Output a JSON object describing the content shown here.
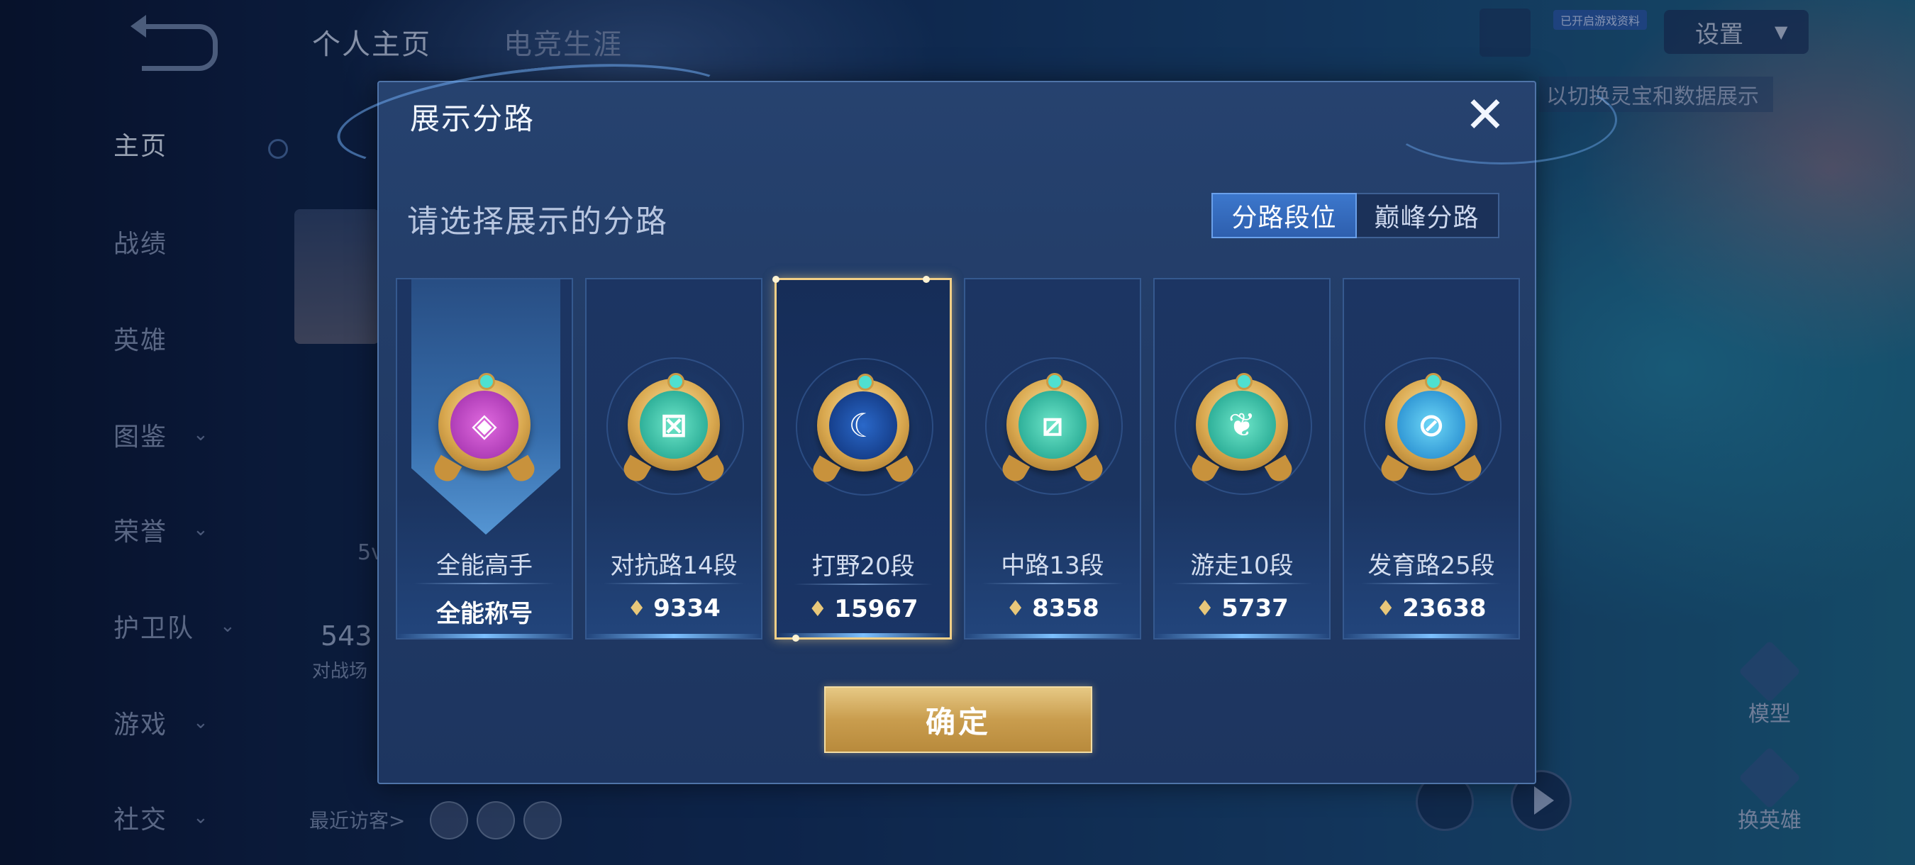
{
  "background": {
    "top_tabs": [
      "个人主页",
      "电竞生涯"
    ],
    "nav_items": [
      {
        "label": "主页",
        "has_chevron": false,
        "active": true
      },
      {
        "label": "战绩",
        "has_chevron": false,
        "active": false
      },
      {
        "label": "英雄",
        "has_chevron": false,
        "active": false
      },
      {
        "label": "图鉴",
        "has_chevron": true,
        "active": false
      },
      {
        "label": "荣誉",
        "has_chevron": true,
        "active": false
      },
      {
        "label": "护卫队",
        "has_chevron": true,
        "active": false
      },
      {
        "label": "游戏",
        "has_chevron": true,
        "active": false
      },
      {
        "label": "社交",
        "has_chevron": true,
        "active": false
      }
    ],
    "settings_label": "设置",
    "hint_text": "以切换灵宝和数据展示",
    "top_badge": "已开启游戏资料",
    "stat_number": "543",
    "stat_caption": "对战场",
    "card_caption": "5v",
    "recent_visitors": "最近访客>",
    "right_buttons": [
      "模型",
      "换英雄"
    ]
  },
  "dialog": {
    "title": "展示分路",
    "close_symbol": "✕",
    "subtitle": "请选择展示的分路",
    "segments": [
      {
        "label": "分路段位",
        "active": true
      },
      {
        "label": "巅峰分路",
        "active": false
      }
    ],
    "cards": [
      {
        "name": "全能高手",
        "score": "全能称号",
        "badge_color": "purple",
        "icon": "all-round-icon",
        "selected": false,
        "has_banner": true,
        "show_points_icon": false
      },
      {
        "name": "对抗路14段",
        "score": "9334",
        "badge_color": "teal",
        "icon": "clash-lane-icon",
        "selected": false,
        "has_banner": false,
        "show_points_icon": true
      },
      {
        "name": "打野20段",
        "score": "15967",
        "badge_color": "blue",
        "icon": "jungle-dragon-icon",
        "selected": true,
        "has_banner": false,
        "show_points_icon": true
      },
      {
        "name": "中路13段",
        "score": "8358",
        "badge_color": "teal",
        "icon": "mid-lane-icon",
        "selected": false,
        "has_banner": false,
        "show_points_icon": true
      },
      {
        "name": "游走10段",
        "score": "5737",
        "badge_color": "teal",
        "icon": "roam-wings-icon",
        "selected": false,
        "has_banner": false,
        "show_points_icon": true
      },
      {
        "name": "发育路25段",
        "score": "23638",
        "badge_color": "cyan",
        "icon": "farm-lane-icon",
        "selected": false,
        "has_banner": false,
        "show_points_icon": true
      }
    ],
    "confirm_label": "确定"
  },
  "colors": {
    "dialog_bg": "#23406b",
    "selected_border": "#f2cf86",
    "confirm_gold": "#c99d4e",
    "active_segment": "#3c77cc"
  }
}
